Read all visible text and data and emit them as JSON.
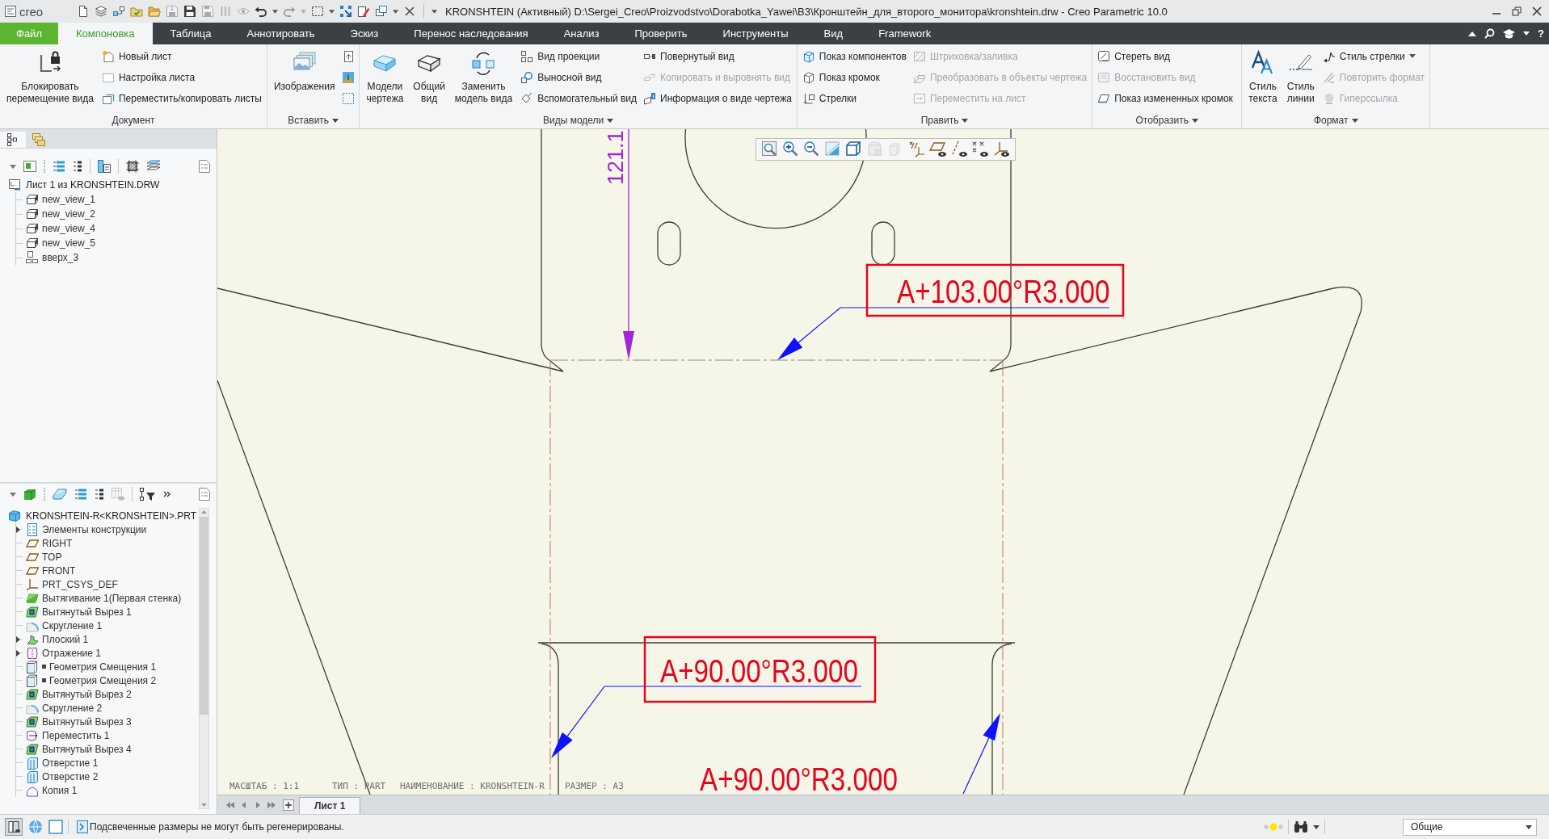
{
  "title_bar": {
    "logo": "creo",
    "quick_access": [
      {
        "kind": "button",
        "disabled": false
      },
      {
        "kind": "button",
        "disabled": false
      },
      {
        "kind": "button",
        "disabled": false
      },
      {
        "kind": "button",
        "disabled": false
      },
      {
        "kind": "button",
        "disabled": false
      },
      {
        "kind": "button",
        "disabled": true
      },
      {
        "kind": "button",
        "disabled": false
      },
      {
        "kind": "button",
        "disabled": true
      },
      {
        "kind": "button",
        "disabled": true
      },
      {
        "kind": "button",
        "disabled": true
      },
      {
        "kind": "button",
        "disabled": false
      },
      {
        "kind": "menu",
        "disabled": false
      },
      {
        "kind": "button",
        "disabled": true
      },
      {
        "kind": "menu",
        "disabled": true
      },
      {
        "kind": "button",
        "disabled": false
      },
      {
        "kind": "menu",
        "disabled": false
      },
      {
        "kind": "button",
        "disabled": false
      },
      {
        "kind": "button",
        "disabled": false
      },
      {
        "kind": "button",
        "disabled": false
      },
      {
        "kind": "menu",
        "disabled": false
      },
      {
        "kind": "button",
        "disabled": false
      },
      {
        "kind": "menu",
        "disabled": false
      }
    ],
    "title": "KRONSHTEIN (Активный) D:\\Sergei_Creo\\Proizvodstvo\\Dorabotka_Yawei\\B3\\Кронштейн_для_второго_монитора\\kronshtein.drw - Creo Parametric 10.0"
  },
  "menu_tabs": [
    {
      "label": "Файл",
      "kind": "file",
      "selected": false
    },
    {
      "label": "Компоновка",
      "kind": "tab",
      "selected": true
    },
    {
      "label": "Таблица",
      "kind": "tab",
      "selected": false
    },
    {
      "label": "Аннотировать",
      "kind": "tab",
      "selected": false
    },
    {
      "label": "Эскиз",
      "kind": "tab",
      "selected": false
    },
    {
      "label": "Перенос наследования",
      "kind": "tab",
      "selected": false
    },
    {
      "label": "Анализ",
      "kind": "tab",
      "selected": false
    },
    {
      "label": "Проверить",
      "kind": "tab",
      "selected": false
    },
    {
      "label": "Инструменты",
      "kind": "tab",
      "selected": false
    },
    {
      "label": "Вид",
      "kind": "tab",
      "selected": false
    },
    {
      "label": "Framework",
      "kind": "tab",
      "selected": false
    }
  ],
  "help": "?",
  "ribbon": [
    {
      "label": "Документ",
      "menu": false,
      "items": [
        {
          "kind": "large",
          "label": "Блокировать\nперемещение вида",
          "disabled": false,
          "menu": false
        },
        {
          "kind": "small",
          "label": "Новый лист",
          "disabled": false,
          "menu": false
        },
        {
          "kind": "small",
          "label": "Настройка листа",
          "disabled": false,
          "menu": false
        },
        {
          "kind": "small",
          "label": "Переместить/копировать листы",
          "disabled": false,
          "menu": false
        }
      ]
    },
    {
      "label": "Вставить",
      "menu": true,
      "items": [
        {
          "kind": "large",
          "label": "Изображения",
          "disabled": false,
          "menu": false
        },
        {
          "kind": "icon",
          "disabled": false,
          "menu": false
        },
        {
          "kind": "icon",
          "disabled": false,
          "menu": false
        },
        {
          "kind": "icon",
          "disabled": false,
          "menu": false
        }
      ]
    },
    {
      "label": "Виды модели",
      "menu": true,
      "items": [
        {
          "kind": "large",
          "label": "Модели\nчертежа",
          "disabled": false,
          "menu": false
        },
        {
          "kind": "large",
          "label": "Общий\nвид",
          "disabled": false,
          "menu": false
        },
        {
          "kind": "large",
          "label": "Заменить\nмодель вида",
          "disabled": false,
          "menu": false
        },
        {
          "kind": "small",
          "label": "Вид проекции",
          "disabled": false,
          "menu": false
        },
        {
          "kind": "small",
          "label": "Выносной вид",
          "disabled": false,
          "menu": false
        },
        {
          "kind": "small",
          "label": "Вспомогательный вид",
          "disabled": false,
          "menu": false
        },
        {
          "kind": "small",
          "label": "Повернутый вид",
          "disabled": false,
          "menu": false
        },
        {
          "kind": "small",
          "label": "Копировать и выровнять вид",
          "disabled": true,
          "menu": false
        },
        {
          "kind": "small",
          "label": "Информация о виде чертежа",
          "disabled": false,
          "menu": false
        }
      ]
    },
    {
      "label": "Править",
      "menu": true,
      "items": [
        {
          "kind": "small",
          "label": "Показ компонентов",
          "disabled": false,
          "menu": false
        },
        {
          "kind": "small",
          "label": "Показ кромок",
          "disabled": false,
          "menu": false
        },
        {
          "kind": "small",
          "label": "Стрелки",
          "disabled": false,
          "menu": false
        },
        {
          "kind": "small",
          "label": "Штриховка/заливка",
          "disabled": true,
          "menu": false
        },
        {
          "kind": "small",
          "label": "Преобразовать в объекты чертежа",
          "disabled": true,
          "menu": false
        },
        {
          "kind": "small",
          "label": "Переместить на лист",
          "disabled": true,
          "menu": false
        }
      ]
    },
    {
      "label": "Отобразить",
      "menu": true,
      "items": [
        {
          "kind": "small",
          "label": "Стереть вид",
          "disabled": false,
          "menu": false
        },
        {
          "kind": "small",
          "label": "Восстановить вид",
          "disabled": true,
          "menu": false
        },
        {
          "kind": "small",
          "label": "Показ измененных кромок",
          "disabled": false,
          "menu": false
        }
      ]
    },
    {
      "label": "Формат",
      "menu": true,
      "items": [
        {
          "kind": "large",
          "label": "Стиль\nтекста",
          "disabled": false,
          "menu": false
        },
        {
          "kind": "large",
          "label": "Стиль\nлинии",
          "disabled": false,
          "menu": false
        },
        {
          "kind": "small",
          "label": "Стиль стрелки",
          "disabled": false,
          "menu": true
        },
        {
          "kind": "small",
          "label": "Повторить формат",
          "disabled": true,
          "menu": false
        },
        {
          "kind": "small",
          "label": "Гиперссылка",
          "disabled": true,
          "menu": false
        }
      ]
    }
  ],
  "drawing_tree": {
    "tabs": [
      {
        "selected": true
      },
      {
        "selected": false
      }
    ],
    "root": {
      "label": "Лист 1 из KRONSHTEIN.DRW",
      "kind": "sheet",
      "children": [
        {
          "label": "new_view_1",
          "kind": "view"
        },
        {
          "label": "new_view_2",
          "kind": "view"
        },
        {
          "label": "new_view_4",
          "kind": "view"
        },
        {
          "label": "new_view_5",
          "kind": "view"
        },
        {
          "label": "вверх_3",
          "kind": "layout"
        }
      ]
    }
  },
  "model_tree": {
    "root": {
      "label": "KRONSHTEIN-R<KRONSHTEIN>.PRT",
      "kind": "part",
      "children": [
        {
          "label": "Элементы конструкции",
          "kind": "list",
          "expandable": true,
          "expanded": false,
          "marked": false
        },
        {
          "label": "RIGHT",
          "kind": "plane",
          "expandable": false,
          "marked": false
        },
        {
          "label": "TOP",
          "kind": "plane",
          "expandable": false,
          "marked": false
        },
        {
          "label": "FRONT",
          "kind": "plane",
          "expandable": false,
          "marked": false
        },
        {
          "label": "PRT_CSYS_DEF",
          "kind": "csys",
          "expandable": false,
          "marked": false
        },
        {
          "label": "Вытягивание 1(Первая стенка)",
          "kind": "extrude",
          "expandable": false,
          "marked": false
        },
        {
          "label": "Вытянутый Вырез 1",
          "kind": "cut",
          "expandable": false,
          "marked": false
        },
        {
          "label": "Скругление 1",
          "kind": "round",
          "expandable": false,
          "marked": false
        },
        {
          "label": "Плоский 1",
          "kind": "flat",
          "expandable": true,
          "expanded": false,
          "marked": false
        },
        {
          "label": "Отражение 1",
          "kind": "mirror",
          "expandable": true,
          "expanded": false,
          "marked": false
        },
        {
          "label": "Геометрия Смещения 1",
          "kind": "offset",
          "expandable": false,
          "marked": true
        },
        {
          "label": "Геометрия Смещения 2",
          "kind": "offset",
          "expandable": false,
          "marked": true
        },
        {
          "label": "Вытянутый Вырез 2",
          "kind": "cut",
          "expandable": false,
          "marked": false
        },
        {
          "label": "Скругление 2",
          "kind": "round",
          "expandable": false,
          "marked": false
        },
        {
          "label": "Вытянутый Вырез 3",
          "kind": "cut",
          "expandable": false,
          "marked": false
        },
        {
          "label": "Переместить 1",
          "kind": "move",
          "expandable": false,
          "marked": false
        },
        {
          "label": "Вытянутый Вырез 4",
          "kind": "cut",
          "expandable": false,
          "marked": false
        },
        {
          "label": "Отверстие 1",
          "kind": "hole",
          "expandable": false,
          "marked": false
        },
        {
          "label": "Отверстие 2",
          "kind": "hole",
          "expandable": false,
          "marked": false
        },
        {
          "label": "Копия 1",
          "kind": "copy",
          "expandable": false,
          "marked": false
        }
      ]
    }
  },
  "sheet_tabs": [
    {
      "label": "Лист 1",
      "selected": true
    }
  ],
  "canvas": {
    "toolbar": [
      {
        "disabled": false
      },
      {
        "disabled": false
      },
      {
        "disabled": false
      },
      {
        "disabled": false
      },
      {
        "disabled": false
      },
      {
        "disabled": true
      },
      {
        "disabled": true
      },
      {
        "disabled": false
      },
      {
        "disabled": false
      },
      {
        "disabled": false
      },
      {
        "disabled": false
      },
      {
        "disabled": false
      }
    ],
    "dimension": "121.1",
    "notes": [
      {
        "text": "A+103.00°R3.000",
        "boxed": true
      },
      {
        "text": "A+90.00°R3.000",
        "boxed": true
      },
      {
        "text": "A+90.00°R3.000",
        "boxed": false
      }
    ],
    "title_block": [
      "МАСШТАБ : 1:1",
      "ТИП : PART",
      "НАИМЕНОВАНИЕ : KRONSHTEIN-R",
      "РАЗМЕР : A3"
    ]
  },
  "status_bar": {
    "message": "Подсвеченные размеры не могут быть регенерированы.",
    "filter": "Общие"
  }
}
